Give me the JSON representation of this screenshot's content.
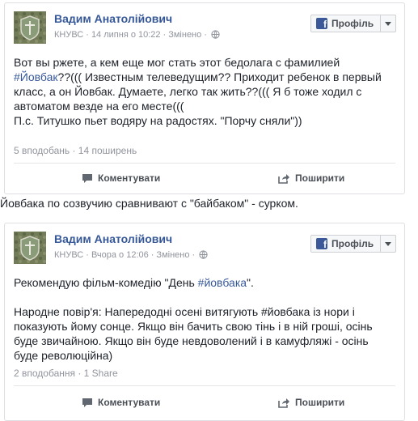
{
  "posts": [
    {
      "author": "Вадим Анатолійович",
      "org": "КНУВС",
      "date": "14 липня о 10:22",
      "edited": "Змінено",
      "profile_button": "Профіль",
      "lines": [
        [
          {
            "t": "Вот вы ржете, а кем еще мог стать этот бедолага с фамилией"
          }
        ],
        [
          {
            "t": "#Йовбак",
            "tag": true
          },
          {
            "t": "??((( Известным телеведущим?? Приходит ребенок в первый"
          }
        ],
        [
          {
            "t": "класс, а он Йовбак. Думаете, легко так жить??((( Я б тоже ходил с"
          }
        ],
        [
          {
            "t": "автоматом везде на его месте((("
          }
        ],
        [
          {
            "t": "П.с. Титушко пьет водяру на радостях. \"Порчу сняли\"))"
          }
        ]
      ],
      "stats": "5 вподобань · 14 поширень",
      "comment_label": "Коментувати",
      "share_label": "Поширити"
    },
    {
      "author": "Вадим Анатолійович",
      "org": "КНУВС",
      "date": "Вчора о 12:06",
      "edited": "Змінено",
      "profile_button": "Профіль",
      "lines": [
        [
          {
            "t": "Рекомендую фільм-комедію \"День "
          },
          {
            "t": "#йовбака",
            "tag": true
          },
          {
            "t": "\"."
          }
        ],
        [
          {
            "t": ""
          }
        ],
        [
          {
            "t": "Народне повір'я: Напередодні осені витягують #йовбака із нори і"
          }
        ],
        [
          {
            "t": "показують йому сонце. Якщо він бачить свою тінь і в ній гроші, осінь"
          }
        ],
        [
          {
            "t": "буде звичайною. Якщо він буде невдоволений і в камуфляжі - осінь"
          }
        ],
        [
          {
            "t": "буде революційна)"
          }
        ]
      ],
      "stats": "2 вподобання · 1 Share",
      "comment_label": "Коментувати",
      "share_label": "Поширити"
    }
  ],
  "caption": "Йовбака по созвучию сравнивают с \"байбаком\" - сурком.",
  "icons": [
    "avatar-emblem",
    "globe-icon",
    "facebook-logo-icon",
    "chevron-down-icon",
    "comment-icon",
    "share-icon"
  ],
  "colors": {
    "link": "#365899",
    "meta": "#90949c",
    "text": "#1d2129",
    "fb_blue": "#3b5998"
  }
}
